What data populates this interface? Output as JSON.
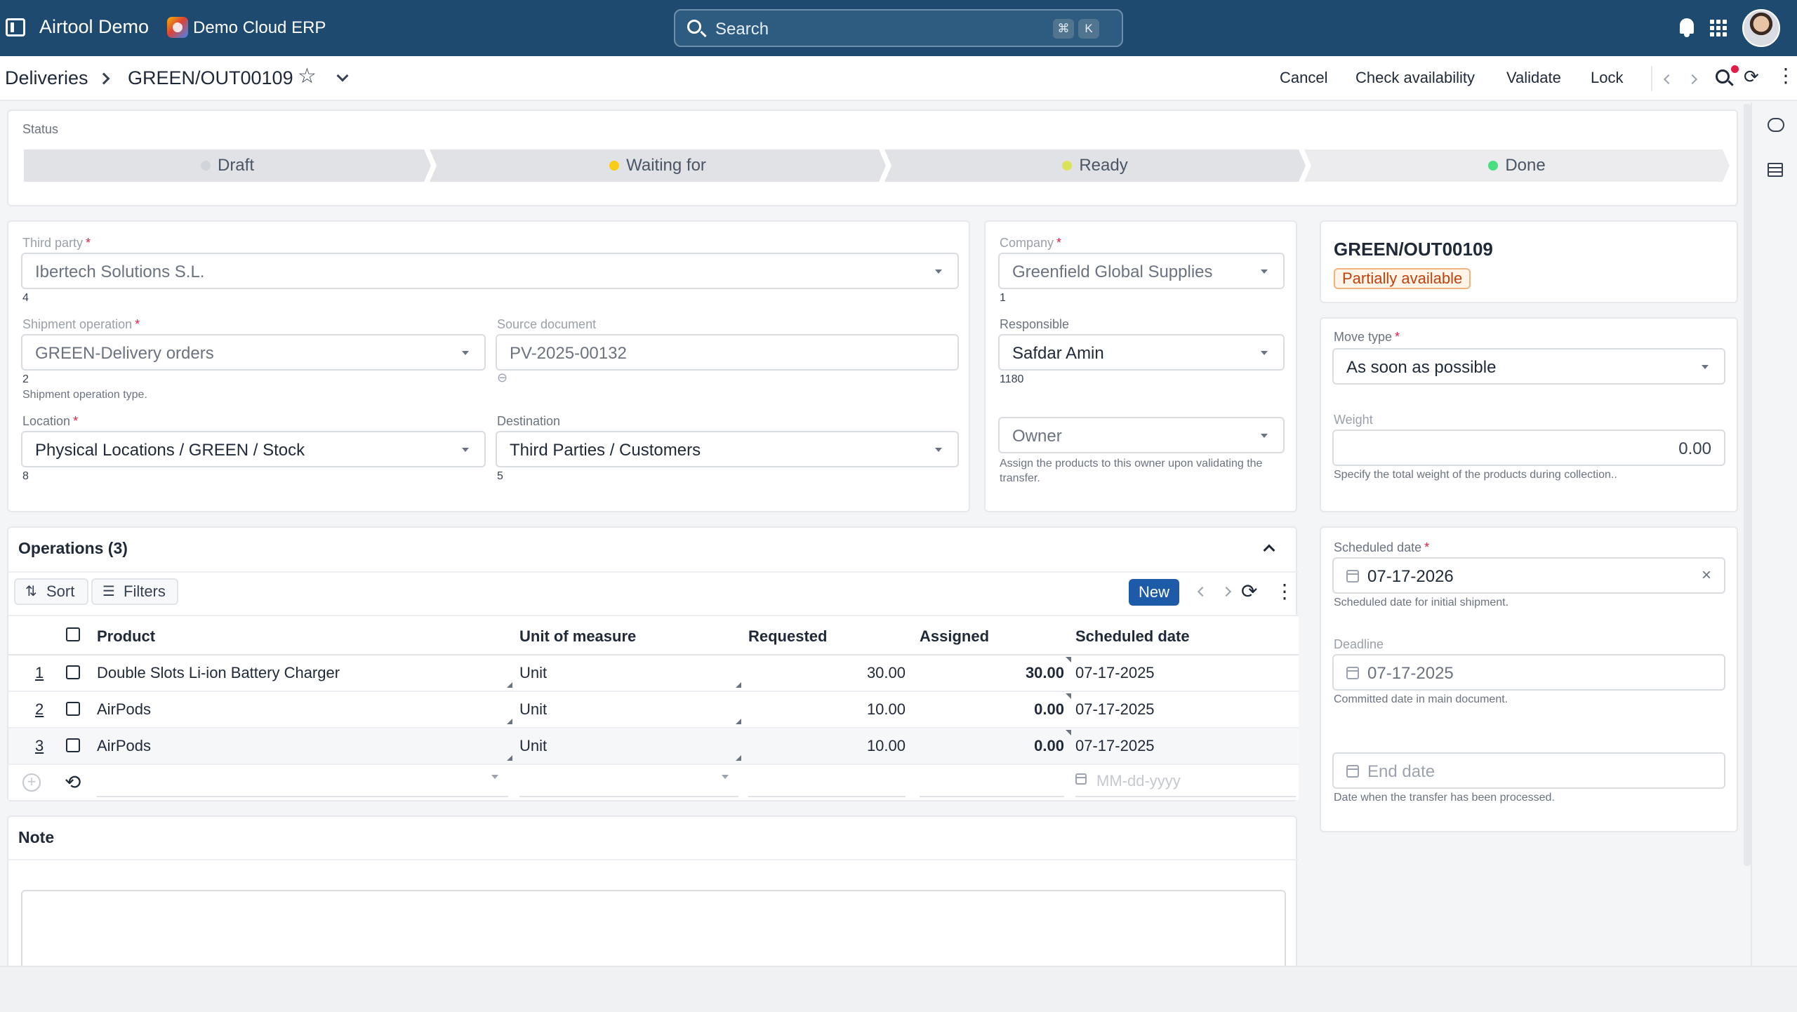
{
  "topbar": {
    "app_name": "Airtool Demo",
    "erp_name": "Demo Cloud ERP",
    "search_placeholder": "Search",
    "kbd_cmd": "⌘",
    "kbd_k": "K"
  },
  "breadcrumb": {
    "root": "Deliveries",
    "current": "GREEN/OUT00109"
  },
  "actions": {
    "cancel": "Cancel",
    "check_availability": "Check availability",
    "validate": "Validate",
    "lock": "Lock"
  },
  "status": {
    "label": "Status",
    "steps": [
      {
        "label": "Draft",
        "dot_color": "#d1d5db"
      },
      {
        "label": "Waiting for",
        "dot_color": "#facc15"
      },
      {
        "label": "Ready",
        "dot_color": "#d9e35a"
      },
      {
        "label": "Done",
        "dot_color": "#4ade80"
      }
    ]
  },
  "form": {
    "third_party": {
      "label": "Third party",
      "value": "Ibertech Solutions S.L.",
      "id": "4"
    },
    "shipment_operation": {
      "label": "Shipment operation",
      "value": "GREEN-Delivery orders",
      "id": "2",
      "hint": "Shipment operation type."
    },
    "source_document": {
      "label": "Source document",
      "value": "PV-2025-00132"
    },
    "location": {
      "label": "Location",
      "value": "Physical Locations / GREEN / Stock",
      "id": "8"
    },
    "destination": {
      "label": "Destination",
      "value": "Third Parties / Customers",
      "id": "5"
    },
    "company": {
      "label": "Company",
      "value": "Greenfield Global Supplies",
      "id": "1"
    },
    "responsible": {
      "label": "Responsible",
      "value": "Safdar Amin",
      "id": "1180"
    },
    "owner": {
      "placeholder": "Owner",
      "hint": "Assign the products to this owner upon validating the transfer."
    }
  },
  "summary": {
    "title": "GREEN/OUT00109",
    "badge": "Partially available"
  },
  "move": {
    "move_type": {
      "label": "Move type",
      "value": "As soon as possible"
    },
    "weight": {
      "label": "Weight",
      "value": "0.00",
      "hint": "Specify the total weight of the products during collection.."
    }
  },
  "dates": {
    "scheduled": {
      "label": "Scheduled date",
      "value": "07-17-2026",
      "hint": "Scheduled date for initial shipment."
    },
    "deadline": {
      "label": "Deadline",
      "value": "07-17-2025",
      "hint": "Committed date in main document."
    },
    "end_date": {
      "placeholder": "End date",
      "hint": "Date when the transfer has been processed."
    }
  },
  "operations": {
    "title": "Operations (3)",
    "sort_label": "Sort",
    "filters_label": "Filters",
    "new_label": "New",
    "columns": [
      "Product",
      "Unit of measure",
      "Requested",
      "Assigned",
      "Scheduled date"
    ],
    "rows": [
      {
        "n": "1",
        "product": "Double Slots Li-ion Battery Charger",
        "uom": "Unit",
        "requested": "30.00",
        "assigned": "30.00",
        "date": "07-17-2025"
      },
      {
        "n": "2",
        "product": "AirPods",
        "uom": "Unit",
        "requested": "10.00",
        "assigned": "0.00",
        "date": "07-17-2025"
      },
      {
        "n": "3",
        "product": "AirPods",
        "uom": "Unit",
        "requested": "10.00",
        "assigned": "0.00",
        "date": "07-17-2025"
      }
    ],
    "new_row_date_placeholder": "MM-dd-yyyy"
  },
  "note": {
    "title": "Note"
  }
}
